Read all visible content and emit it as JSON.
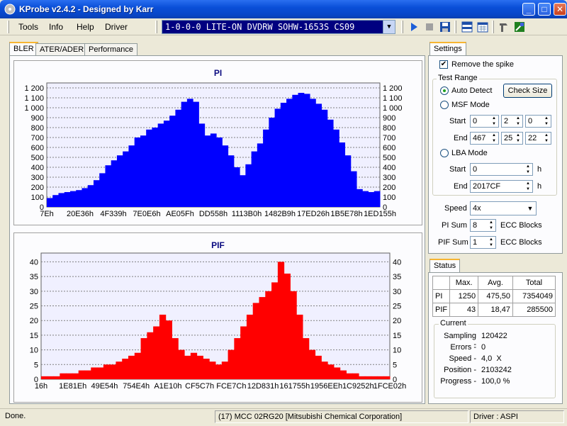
{
  "window": {
    "title": "KProbe v2.4.2 - Designed by Karr"
  },
  "menu": {
    "items": [
      "Tools",
      "Info",
      "Help",
      "Driver"
    ]
  },
  "toolbar": {
    "drive": "1-0-0-0 LITE-ON DVDRW SOHW-1653S CS09"
  },
  "tabs": [
    "BLER",
    "ATER/ADER",
    "Performance"
  ],
  "settings": {
    "tab_label": "Settings",
    "remove_spike_label": "Remove the spike",
    "remove_spike_checked": true,
    "test_range_label": "Test Range",
    "auto_detect_label": "Auto Detect",
    "check_size_label": "Check Size",
    "msf_mode_label": "MSF Mode",
    "start_label": "Start",
    "end_label": "End",
    "msf_start": [
      "0",
      "2",
      "0"
    ],
    "msf_end": [
      "467",
      "25",
      "22"
    ],
    "lba_mode_label": "LBA Mode",
    "lba_start": "0",
    "lba_end": "2017CF",
    "hex_suffix": "h",
    "speed_label": "Speed",
    "speed_value": "4x",
    "pi_sum_label": "PI Sum",
    "pi_sum_value": "8",
    "pif_sum_label": "PIF Sum",
    "pif_sum_value": "1",
    "ecc_blocks_label": "ECC Blocks"
  },
  "status": {
    "tab_label": "Status",
    "headers": [
      "",
      "Max.",
      "Avg.",
      "Total"
    ],
    "rows": [
      [
        "PI",
        "1250",
        "475,50",
        "7354049"
      ],
      [
        "PIF",
        "43",
        "18,47",
        "285500"
      ]
    ],
    "current_label": "Current",
    "current": [
      {
        "label": "Sampling -",
        "value": "120422"
      },
      {
        "label": "Errors -",
        "value": "0"
      },
      {
        "label": "Speed -",
        "value": "4,0  X"
      },
      {
        "label": "Position -",
        "value": "2103242"
      },
      {
        "label": "Progress -",
        "value": "100,0 %"
      }
    ]
  },
  "statusbar": {
    "left": "Done.",
    "media": "(17) MCC 02RG20   [Mitsubishi Chemical Corporation]",
    "driver": "Driver : ASPI"
  },
  "colors": {
    "pi": "#0000ff",
    "pif": "#ff0000",
    "title": "#0a0a80"
  },
  "chart_data": [
    {
      "type": "area",
      "title": "PI",
      "ylim": [
        0,
        1250
      ],
      "y_ticks": [
        0,
        100,
        200,
        300,
        400,
        500,
        600,
        700,
        800,
        900,
        1000,
        1100,
        1200
      ],
      "y_tick_labels": [
        "0",
        "100",
        "200",
        "300",
        "400",
        "500",
        "600",
        "700",
        "800",
        "900",
        "1 000",
        "1 100",
        "1 200"
      ],
      "x_tick_labels": [
        "7Eh",
        "20E36h",
        "4F339h",
        "7E0E6h",
        "AE05Fh",
        "DD558h",
        "1113B0h",
        "1482B9h",
        "17ED26h",
        "1B5E78h",
        "1ED155h"
      ],
      "grid": true,
      "series": [
        {
          "color": "#0000ff",
          "values": [
            90,
            120,
            140,
            150,
            160,
            170,
            190,
            220,
            270,
            340,
            420,
            470,
            520,
            560,
            620,
            700,
            720,
            780,
            800,
            840,
            870,
            920,
            980,
            1060,
            1090,
            1060,
            840,
            720,
            740,
            700,
            620,
            520,
            400,
            320,
            430,
            560,
            640,
            780,
            900,
            990,
            1050,
            1090,
            1130,
            1150,
            1140,
            1090,
            1040,
            980,
            880,
            780,
            650,
            520,
            360,
            180,
            160,
            150,
            160
          ]
        }
      ]
    },
    {
      "type": "area",
      "title": "PIF",
      "ylim": [
        0,
        43
      ],
      "y_ticks": [
        0,
        5,
        10,
        15,
        20,
        25,
        30,
        35,
        40
      ],
      "y_tick_labels": [
        "0",
        "5",
        "10",
        "15",
        "20",
        "25",
        "30",
        "35",
        "40"
      ],
      "x_tick_labels": [
        "16h",
        "1E81Eh",
        "49E54h",
        "754E4h",
        "A1E10h",
        "CF5C7h",
        "FCE7Ch",
        "12D831h",
        "161755h",
        "1956EEh",
        "1C9252h",
        "1FCE02h"
      ],
      "grid": true,
      "series": [
        {
          "color": "#ff0000",
          "values": [
            1,
            1,
            1,
            2,
            2,
            2,
            3,
            3,
            4,
            4,
            5,
            5,
            6,
            7,
            8,
            9,
            14,
            16,
            18,
            22,
            20,
            14,
            10,
            8,
            9,
            8,
            7,
            6,
            5,
            6,
            10,
            14,
            18,
            22,
            26,
            28,
            30,
            33,
            40,
            36,
            30,
            22,
            14,
            10,
            8,
            6,
            5,
            4,
            3,
            2,
            2,
            1,
            1,
            1,
            1,
            1
          ]
        }
      ]
    }
  ]
}
